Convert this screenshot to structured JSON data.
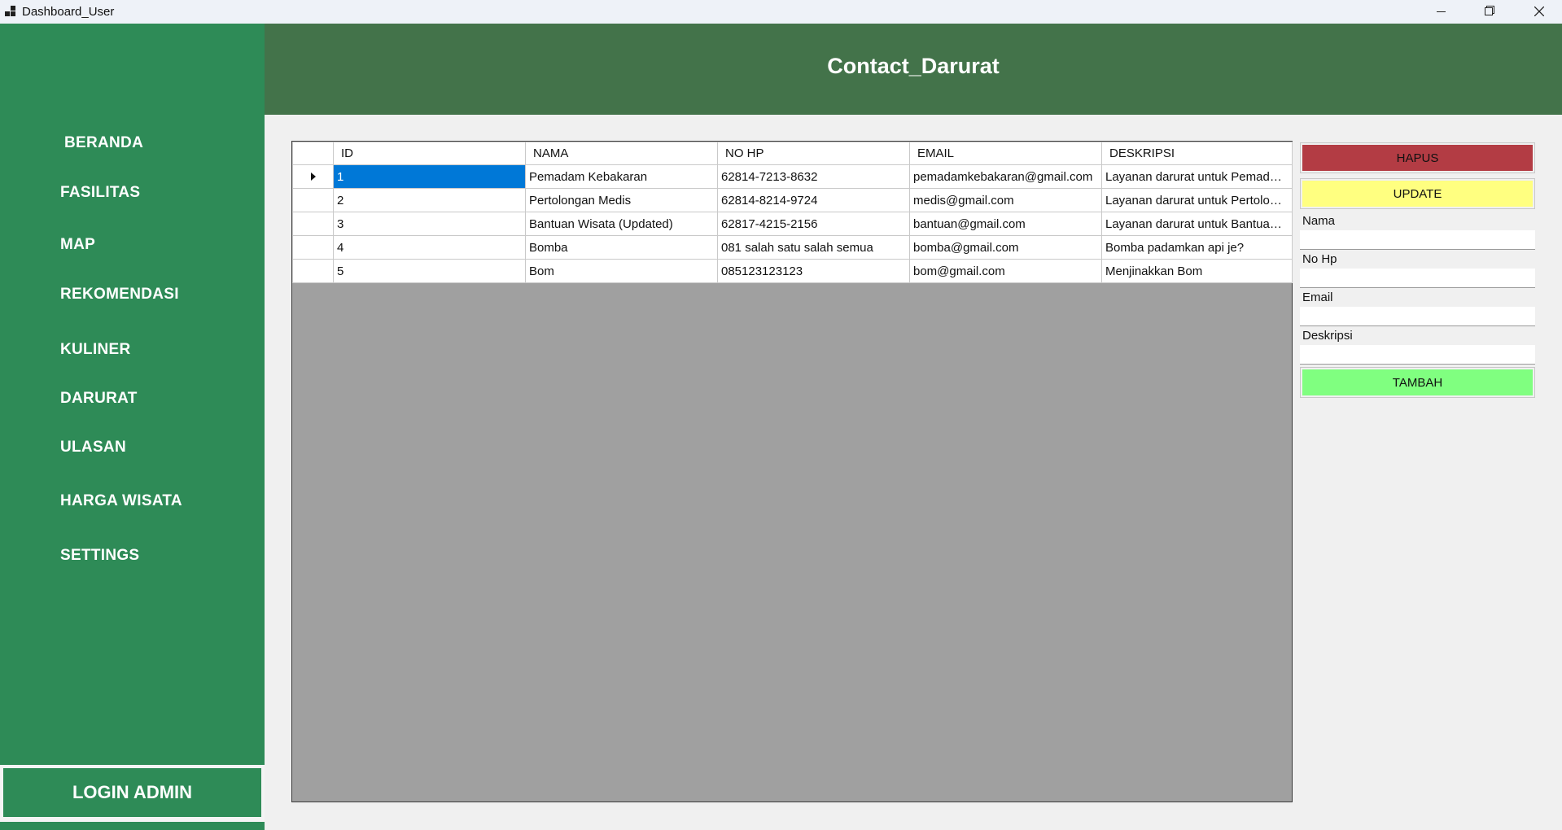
{
  "window": {
    "title": "Dashboard_User",
    "controls": {
      "minimize": "minimize-icon",
      "maximize": "restore-icon",
      "close": "close-icon"
    }
  },
  "sidebar": {
    "items": [
      {
        "label": "BERANDA"
      },
      {
        "label": "FASILITAS"
      },
      {
        "label": "MAP"
      },
      {
        "label": "REKOMENDASI"
      },
      {
        "label": "KULINER"
      },
      {
        "label": "DARURAT"
      },
      {
        "label": "ULASAN"
      },
      {
        "label": "HARGA WISATA"
      },
      {
        "label": "SETTINGS"
      }
    ],
    "login_label": "LOGIN ADMIN"
  },
  "header": {
    "title": "Contact_Darurat"
  },
  "grid": {
    "columns": [
      "ID",
      "NAMA",
      "NO HP",
      "EMAIL",
      "DESKRIPSI"
    ],
    "rows": [
      [
        "1",
        "Pemadam Kebakaran",
        "62814-7213-8632",
        "pemadamkebakaran@gmail.com",
        "Layanan darurat untuk Pemadam…"
      ],
      [
        "2",
        "Pertolongan Medis",
        "62814-8214-9724",
        "medis@gmail.com",
        "Layanan darurat untuk Pertolong…"
      ],
      [
        "3",
        "Bantuan Wisata (Updated)",
        "62817-4215-2156",
        "bantuan@gmail.com",
        "Layanan darurat untuk Bantuan …"
      ],
      [
        "4",
        "Bomba",
        "081 salah satu salah semua",
        "bomba@gmail.com",
        "Bomba padamkan api je?"
      ],
      [
        "5",
        "Bom",
        "085123123123",
        "bom@gmail.com",
        "Menjinakkan Bom"
      ]
    ],
    "selected_row": 1
  },
  "form": {
    "delete_label": "HAPUS",
    "update_label": "UPDATE",
    "fields": [
      {
        "label": "Nama",
        "value": ""
      },
      {
        "label": "No Hp",
        "value": ""
      },
      {
        "label": "Email",
        "value": ""
      },
      {
        "label": "Deskripsi",
        "value": ""
      }
    ],
    "add_label": "TAMBAH"
  },
  "colors": {
    "sidebar": "#2e8b57",
    "header": "#43734a",
    "delete": "#b33c44",
    "update": "#ffff80",
    "add": "#80ff80",
    "selection": "#0078d7"
  }
}
